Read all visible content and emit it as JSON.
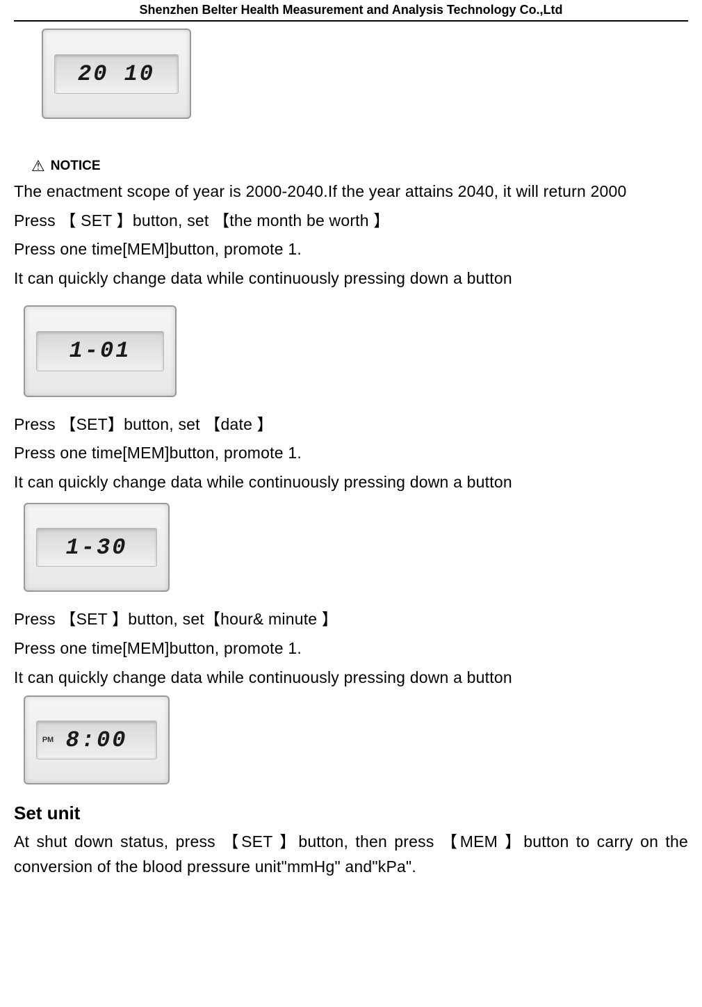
{
  "header": {
    "title": "Shenzhen Belter Health Measurement and Analysis Technology Co.,Ltd"
  },
  "lcd": {
    "box1": "20 10",
    "box2": "1-01",
    "box3": "1-30",
    "box4_prefix": "PM",
    "box4": "8:00"
  },
  "notice": {
    "label": "NOTICE"
  },
  "paragraphs": {
    "p1": "The enactment scope of year is 2000-2040.If the year attains 2040, it will return 2000",
    "p2": "Press 【 SET 】button, set  【the month be worth 】",
    "p3": "Press one time[MEM]button, promote 1.",
    "p4": "It can quickly change data while continuously pressing down a button",
    "p5": "Press 【SET】button, set 【date 】",
    "p6": "Press one time[MEM]button, promote 1.",
    "p7": "It can quickly change data while continuously pressing down a button",
    "p8": "Press 【SET 】button, set【hour& minute 】",
    "p9": "Press one time[MEM]button, promote 1.",
    "p10": "It can quickly change data while continuously pressing down a button",
    "heading": "Set unit",
    "p11": "At shut down status, press 【SET 】button, then press 【MEM 】button to carry on the conversion of the blood pressure unit\"mmHg\" and\"kPa\"."
  }
}
